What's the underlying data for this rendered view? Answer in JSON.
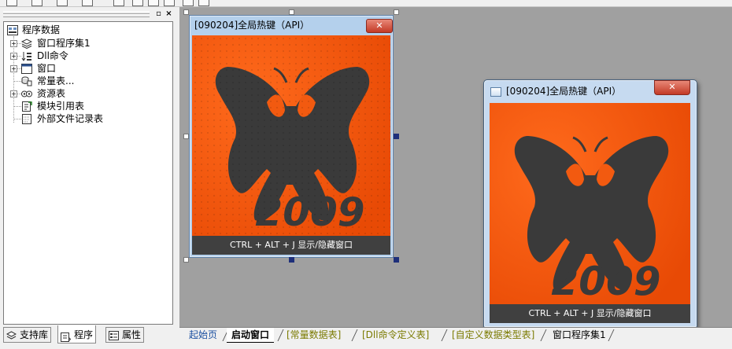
{
  "left_panel": {
    "tree": {
      "root": "程序数据",
      "items": [
        {
          "label": "窗口程序集1",
          "icon": "stack-icon",
          "expandable": true
        },
        {
          "label": "Dll命令",
          "icon": "dll-arrow-icon",
          "expandable": true
        },
        {
          "label": "窗口",
          "icon": "window-icon",
          "expandable": true
        },
        {
          "label": "常量表...",
          "icon": "constant-table-icon",
          "expandable": false
        },
        {
          "label": "资源表",
          "icon": "resource-icon",
          "expandable": true
        },
        {
          "label": "模块引用表",
          "icon": "module-ref-icon",
          "expandable": false
        },
        {
          "label": "外部文件记录表",
          "icon": "file-record-icon",
          "expandable": false
        }
      ]
    },
    "bottom_tabs": [
      "支持库",
      "程序",
      "属性"
    ]
  },
  "design_form": {
    "title": "[090204]全局热键（API）",
    "caption": "CTRL + ALT + J 显示/隐藏窗口",
    "year": "2009"
  },
  "runtime_window": {
    "title": "[090204]全局热键（API）",
    "caption": "CTRL + ALT + J 显示/隐藏窗口",
    "year": "2009"
  },
  "doc_tabs": [
    {
      "label": "起始页",
      "color": "#1a4fa0",
      "active": false
    },
    {
      "label": "启动窗口",
      "color": "#000000",
      "active": true
    },
    {
      "label": "[常量数据表]",
      "color": "#7a7a00",
      "active": false
    },
    {
      "label": "[Dll命令定义表]",
      "color": "#7a7a00",
      "active": false
    },
    {
      "label": "[自定义数据类型表]",
      "color": "#7a7a00",
      "active": false
    },
    {
      "label": "窗口程序集1",
      "color": "#000000",
      "active": false
    }
  ],
  "colors": {
    "picture_orange": "#f25a10",
    "butterfly": "#3a3a3a",
    "caption_bar": "#404040",
    "workspace": "#a0a0a0"
  }
}
